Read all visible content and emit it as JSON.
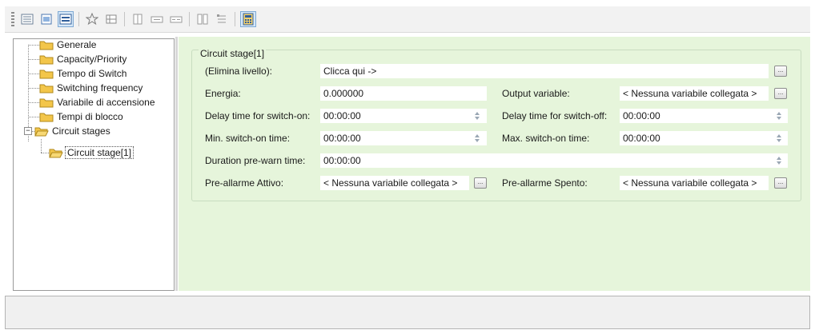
{
  "toolbar": {
    "buttons": [
      {
        "icon": "tree-view-icon"
      },
      {
        "icon": "document-icon"
      },
      {
        "icon": "form-view-icon",
        "active": true
      },
      {
        "icon": "star-icon"
      },
      {
        "icon": "grid-icon"
      },
      {
        "icon": "column-icon"
      },
      {
        "icon": "field-icon"
      },
      {
        "icon": "field-alt-icon"
      },
      {
        "icon": "align-icon"
      },
      {
        "icon": "list-icon"
      },
      {
        "icon": "calculator-icon",
        "active": true
      }
    ]
  },
  "tree": {
    "items": [
      {
        "label": "Generale"
      },
      {
        "label": "Capacity/Priority"
      },
      {
        "label": "Tempo di Switch"
      },
      {
        "label": "Switching frequency"
      },
      {
        "label": "Variabile di accensione"
      },
      {
        "label": "Tempi di blocco"
      },
      {
        "label": "Circuit stages",
        "expander": "−"
      },
      {
        "label": "Circuit stage[1]"
      }
    ]
  },
  "form": {
    "group_title": "Circuit stage[1]",
    "elimina_label": "(Elimina livello):",
    "elimina_value": "Clicca qui ->",
    "energia_label": "Energia:",
    "energia_value": "0.000000",
    "output_label": "Output variable:",
    "output_value": "< Nessuna variabile collegata >",
    "delay_on_label": "Delay time for switch-on:",
    "delay_on_value": "00:00:00",
    "delay_off_label": "Delay time for switch-off:",
    "delay_off_value": "00:00:00",
    "min_on_label": "Min. switch-on time:",
    "min_on_value": "00:00:00",
    "max_on_label": "Max. switch-on time:",
    "max_on_value": "00:00:00",
    "prewarn_label": "Duration pre-warn time:",
    "prewarn_value": "00:00:00",
    "pre_on_label": "Pre-allarme Attivo:",
    "pre_on_value": "< Nessuna variabile collegata >",
    "pre_off_label": "Pre-allarme Spento:",
    "pre_off_value": "< Nessuna variabile collegata >",
    "dots": "..."
  },
  "status": {
    "text": ""
  },
  "colors": {
    "panel_bg": "#e6f5db",
    "folder": "#f3c64a",
    "active_button": "#d7e8f7"
  }
}
